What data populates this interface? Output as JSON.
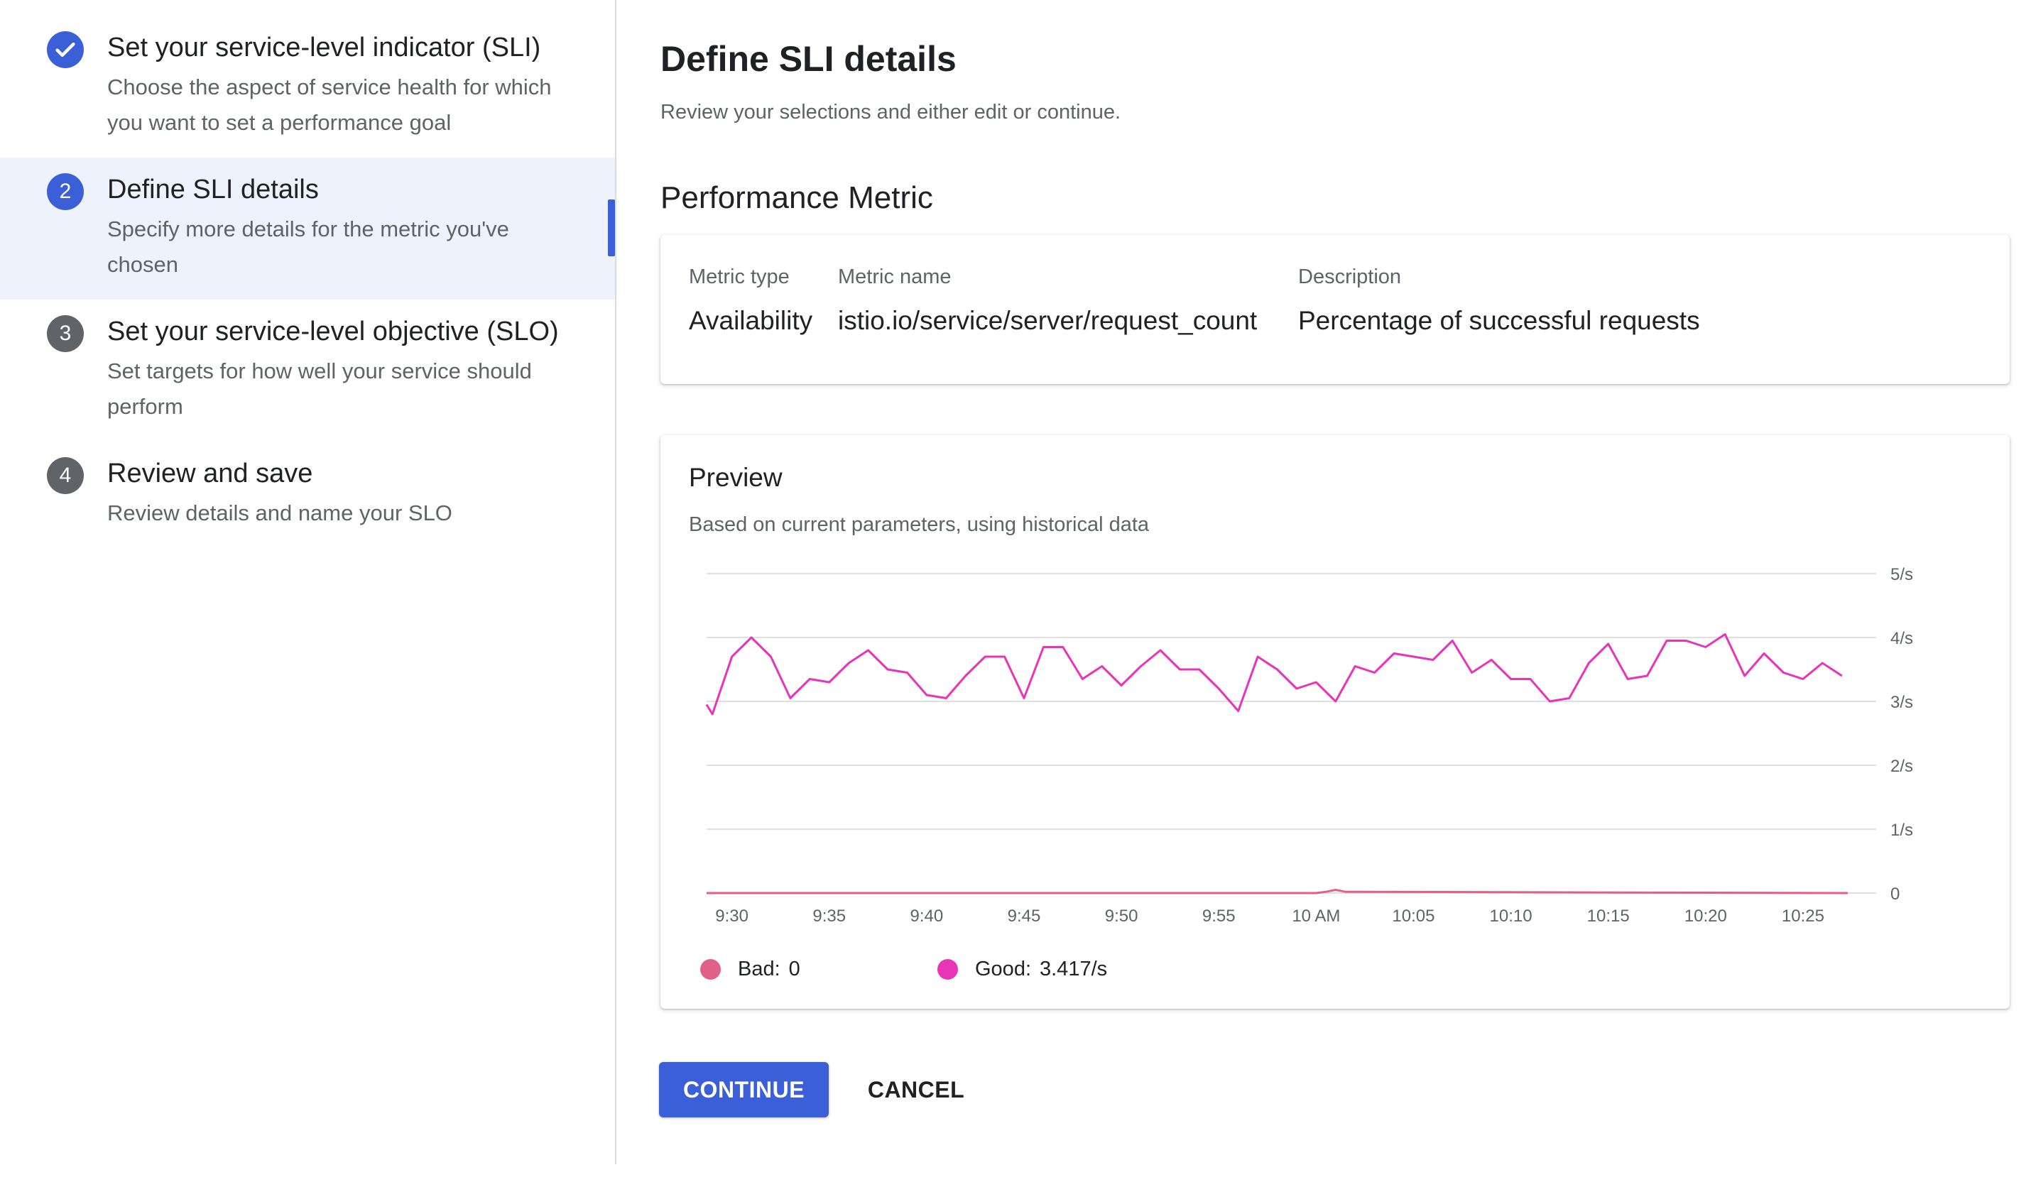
{
  "stepper": {
    "steps": [
      {
        "number": "",
        "icon": "check-icon",
        "status": "done",
        "title": "Set your service-level indicator (SLI)",
        "description": "Choose the aspect of service health for which you want to set a performance goal"
      },
      {
        "number": "2",
        "status": "current",
        "title": "Define SLI details",
        "description": "Specify more details for the metric you've chosen"
      },
      {
        "number": "3",
        "status": "todo",
        "title": "Set your service-level objective (SLO)",
        "description": "Set targets for how well your service should perform"
      },
      {
        "number": "4",
        "status": "todo",
        "title": "Review and save",
        "description": "Review details and name your SLO"
      }
    ]
  },
  "main": {
    "title": "Define SLI details",
    "subtitle": "Review your selections and either edit or continue.",
    "section_title": "Performance Metric",
    "metric": {
      "type_label": "Metric type",
      "type_value": "Availability",
      "name_label": "Metric name",
      "name_value": "istio.io/service/server/request_count",
      "desc_label": "Description",
      "desc_value": "Percentage of successful requests"
    },
    "preview": {
      "title": "Preview",
      "subtitle": "Based on current parameters, using historical data",
      "legend": [
        {
          "label": "Bad:",
          "value": "0",
          "color": "#e0608a"
        },
        {
          "label": "Good:",
          "value": "3.417/s",
          "color": "#e834b6"
        }
      ]
    },
    "buttons": {
      "continue": "CONTINUE",
      "cancel": "CANCEL"
    }
  },
  "colors": {
    "accent": "#3b5fd6",
    "good_series": "#e834b6",
    "bad_series": "#e0608a"
  },
  "chart_data": {
    "type": "line",
    "title": "",
    "xlabel": "",
    "ylabel": "",
    "ylim": [
      0,
      5
    ],
    "y_ticks": [
      {
        "value": 0,
        "label": "0"
      },
      {
        "value": 1,
        "label": "1/s"
      },
      {
        "value": 2,
        "label": "2/s"
      },
      {
        "value": 3,
        "label": "3/s"
      },
      {
        "value": 4,
        "label": "4/s"
      },
      {
        "value": 5,
        "label": "5/s"
      }
    ],
    "x_ticks": [
      "9:30",
      "9:35",
      "9:40",
      "9:45",
      "9:50",
      "9:55",
      "10 AM",
      "10:05",
      "10:10",
      "10:15",
      "10:20",
      "10:25"
    ],
    "x_minutes_range": [
      28.7,
      87.3
    ],
    "x_tick_minutes": [
      30,
      35,
      40,
      45,
      50,
      55,
      60,
      65,
      70,
      75,
      80,
      85
    ],
    "grid": true,
    "series": [
      {
        "name": "Good",
        "color": "#e834b6",
        "x": [
          28.7,
          29.0,
          30.0,
          31.0,
          32.0,
          33.0,
          34.0,
          35.0,
          36.0,
          37.0,
          38.0,
          39.0,
          40.0,
          41.0,
          42.0,
          43.0,
          44.0,
          45.0,
          46.0,
          47.0,
          48.0,
          49.0,
          50.0,
          51.0,
          52.0,
          53.0,
          54.0,
          55.0,
          56.0,
          57.0,
          58.0,
          59.0,
          60.0,
          61.0,
          62.0,
          63.0,
          64.0,
          65.0,
          66.0,
          67.0,
          68.0,
          69.0,
          70.0,
          71.0,
          72.0,
          73.0,
          74.0,
          75.0,
          76.0,
          77.0,
          78.0,
          79.0,
          80.0,
          81.0,
          82.0,
          83.0,
          84.0,
          85.0,
          86.0,
          87.0
        ],
        "values": [
          2.95,
          2.8,
          3.7,
          4.0,
          3.7,
          3.05,
          3.35,
          3.3,
          3.6,
          3.8,
          3.5,
          3.45,
          3.1,
          3.05,
          3.4,
          3.7,
          3.7,
          3.05,
          3.85,
          3.85,
          3.35,
          3.55,
          3.25,
          3.55,
          3.8,
          3.5,
          3.5,
          3.2,
          2.85,
          3.7,
          3.5,
          3.2,
          3.3,
          3.0,
          3.55,
          3.45,
          3.75,
          3.7,
          3.65,
          3.95,
          3.45,
          3.65,
          3.35,
          3.35,
          3.0,
          3.05,
          3.6,
          3.9,
          3.35,
          3.4,
          3.95,
          3.95,
          3.85,
          4.05,
          3.4,
          3.75,
          3.45,
          3.35,
          3.6,
          3.4
        ]
      },
      {
        "name": "Bad",
        "color": "#e0608a",
        "x": [
          28.7,
          60.0,
          60.5,
          61.0,
          61.5,
          87.3
        ],
        "values": [
          0,
          0,
          0.02,
          0.05,
          0.02,
          0
        ]
      }
    ]
  }
}
